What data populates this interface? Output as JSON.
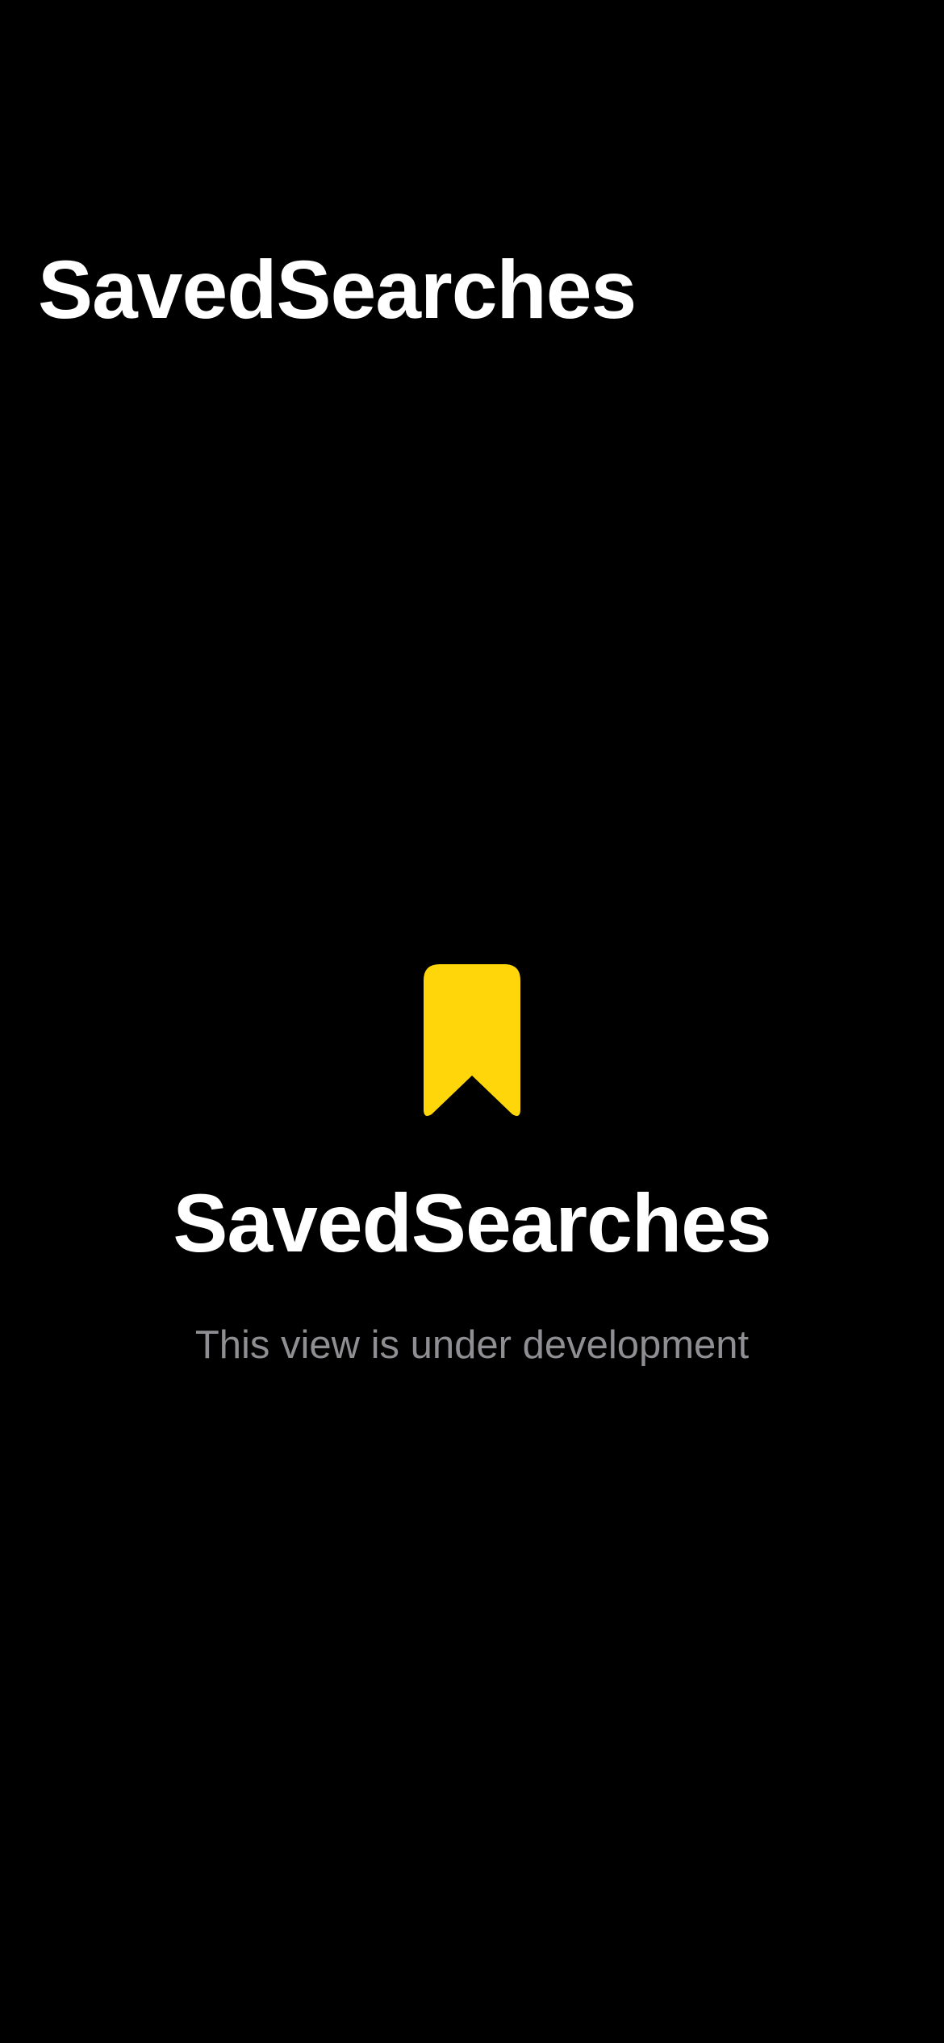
{
  "nav": {
    "title": "SavedSearches"
  },
  "empty_state": {
    "icon": "bookmark-icon",
    "icon_color": "#FFD60A",
    "title": "SavedSearches",
    "subtitle": "This view is under development"
  },
  "colors": {
    "background": "#000000",
    "title_text": "#FFFFFF",
    "subtitle_text": "#8E8E93",
    "accent": "#FFD60A"
  }
}
